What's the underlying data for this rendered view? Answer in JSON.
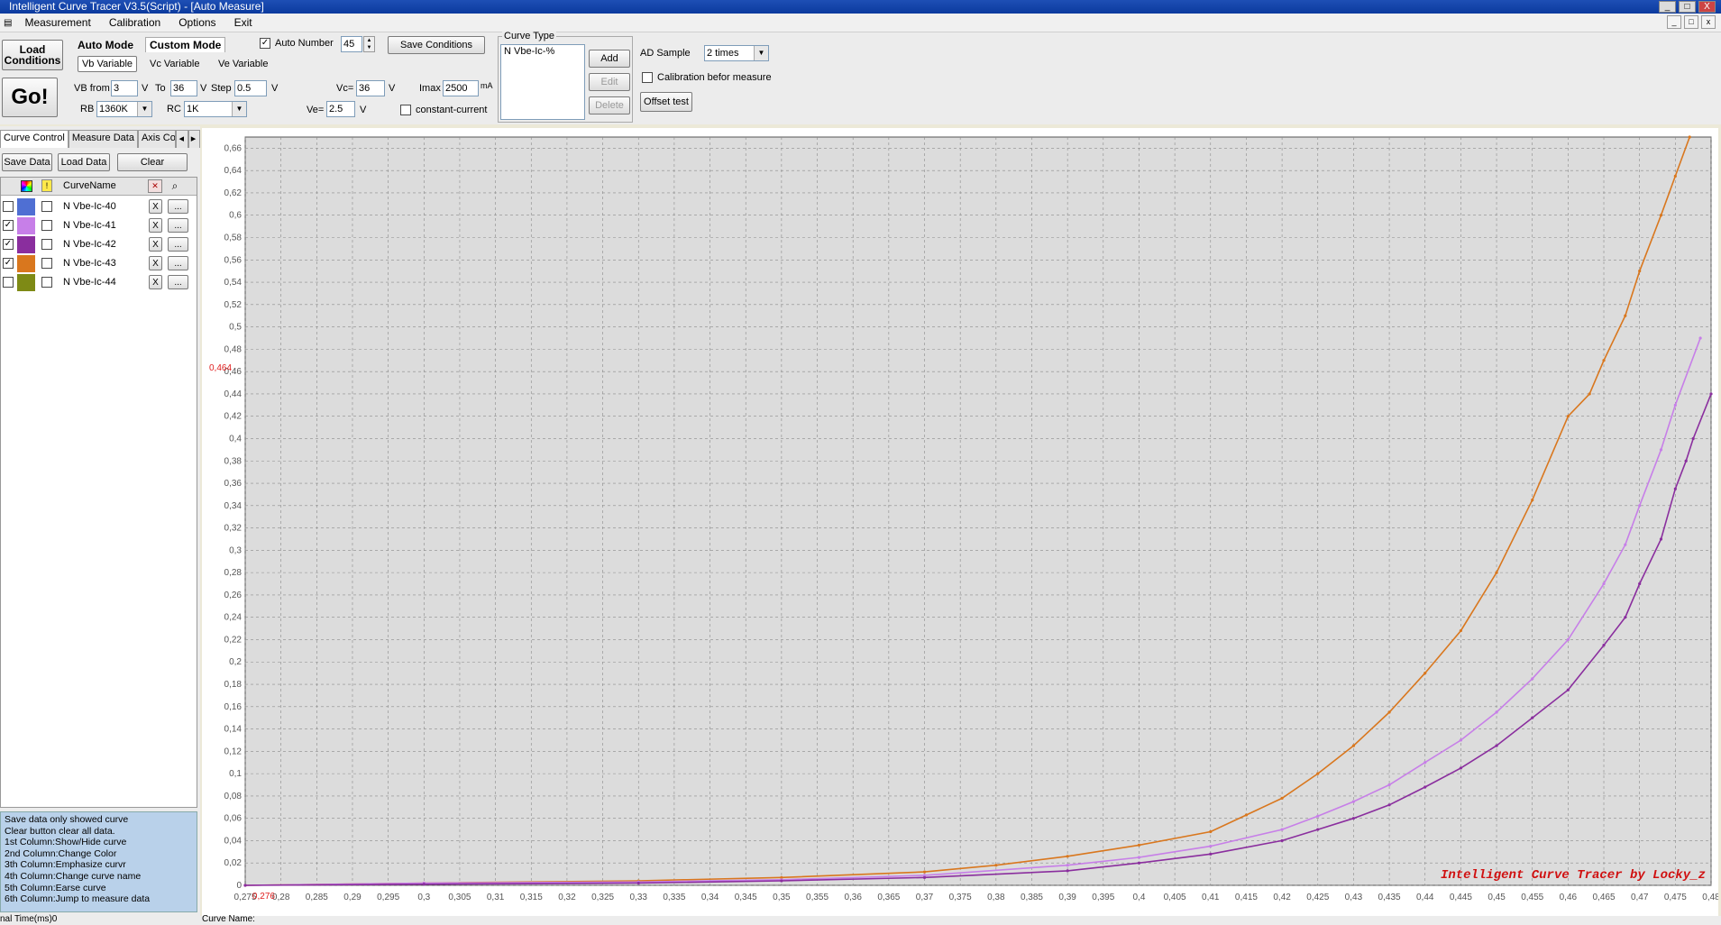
{
  "window": {
    "title": "Intelligent Curve Tracer V3.5(Script) - [Auto Measure]",
    "controls": [
      "_",
      "□",
      "X"
    ],
    "mdi_controls": [
      "_",
      "□",
      "x"
    ]
  },
  "menu": [
    "Measurement",
    "Calibration",
    "Options",
    "Exit"
  ],
  "toolbar": {
    "load_conditions": "Load Conditions",
    "go": "Go!",
    "auto_mode": "Auto Mode",
    "custom_mode": "Custom Mode",
    "vb_variable": "Vb Variable",
    "vc_variable": "Vc Variable",
    "ve_variable": "Ve Variable",
    "auto_number_label": "Auto Number",
    "auto_number_checked": "✓",
    "auto_number_value": "45",
    "save_conditions": "Save Conditions",
    "vb_from_label": "VB from",
    "vb_from": "3",
    "unit_v": "V",
    "to_label": "To",
    "to_value": "36",
    "step_label": "Step",
    "step_value": "0.5",
    "vc_label": "Vc=",
    "vc_value": "36",
    "imax_label": "Imax",
    "imax_value": "2500",
    "imax_unit": "mA",
    "rb_label": "RB",
    "rb_value": "1360K",
    "rc_label": "RC",
    "rc_value": "1K",
    "ve_label": "Ve=",
    "ve_value": "2.5",
    "constant_current": "constant-current",
    "curve_type_title": "Curve Type",
    "curve_type_item": "N Vbe-Ic-%",
    "add": "Add",
    "edit": "Edit",
    "delete": "Delete",
    "ad_sample_label": "AD Sample",
    "ad_sample_value": "2 times",
    "calibration_before": "Calibration befor measure",
    "offset_test": "Offset test"
  },
  "sidebar": {
    "tabs": [
      "Curve Control",
      "Measure Data",
      "Axis Co"
    ],
    "save_data": "Save Data",
    "load_data": "Load Data",
    "clear": "Clear",
    "column_header": "CurveName",
    "curves": [
      {
        "name": "N Vbe-Ic-40",
        "color": "#4f6fd3",
        "shown": "",
        "x": "X",
        "more": "..."
      },
      {
        "name": "N Vbe-Ic-41",
        "color": "#c77fe8",
        "shown": "✓",
        "x": "X",
        "more": "..."
      },
      {
        "name": "N Vbe-Ic-42",
        "color": "#8a2e9e",
        "shown": "✓",
        "x": "X",
        "more": "..."
      },
      {
        "name": "N Vbe-Ic-43",
        "color": "#d9771e",
        "shown": "✓",
        "x": "X",
        "more": "..."
      },
      {
        "name": "N Vbe-Ic-44",
        "color": "#7e8a15",
        "shown": "",
        "x": "X",
        "more": "..."
      }
    ],
    "help_lines": [
      " Save data only showed curve",
      " Clear button clear all data.",
      "1st Column:Show/Hide curve",
      "2nd Column:Change Color",
      "3th Column:Emphasize curvr",
      "4th Column:Change curve name",
      "5th Column:Earse curve",
      "6th Column:Jump to measure data"
    ]
  },
  "status": {
    "left": "nal  Time(ms)0",
    "right": "Curve Name:"
  },
  "chart_data": {
    "type": "line",
    "watermark": "Intelligent Curve Tracer by Locky_z",
    "cursor_y_label": "0,464",
    "cursor_x_label": "0,276",
    "xlim": [
      0.275,
      0.48
    ],
    "ylim": [
      0,
      0.67
    ],
    "x_ticks": [
      "0,275",
      "0,28",
      "0,285",
      "0,29",
      "0,295",
      "0,3",
      "0,305",
      "0,31",
      "0,315",
      "0,32",
      "0,325",
      "0,33",
      "0,335",
      "0,34",
      "0,345",
      "0,35",
      "0,355",
      "0,36",
      "0,365",
      "0,37",
      "0,375",
      "0,38",
      "0,385",
      "0,39",
      "0,395",
      "0,4",
      "0,405",
      "0,41",
      "0,415",
      "0,42",
      "0,425",
      "0,43",
      "0,435",
      "0,44",
      "0,445",
      "0,45",
      "0,455",
      "0,46",
      "0,465",
      "0,47",
      "0,475",
      "0,48"
    ],
    "y_ticks": [
      "0",
      "0,02",
      "0,04",
      "0,06",
      "0,08",
      "0,1",
      "0,12",
      "0,14",
      "0,16",
      "0,18",
      "0,2",
      "0,22",
      "0,24",
      "0,26",
      "0,28",
      "0,3",
      "0,32",
      "0,34",
      "0,36",
      "0,38",
      "0,4",
      "0,42",
      "0,44",
      "0,46",
      "0,48",
      "0,5",
      "0,52",
      "0,54",
      "0,56",
      "0,58",
      "0,6",
      "0,62",
      "0,64",
      "0,66"
    ],
    "grid": true,
    "series": [
      {
        "name": "N Vbe-Ic-43",
        "color": "#d9771e",
        "x": [
          0.275,
          0.3,
          0.33,
          0.35,
          0.37,
          0.38,
          0.39,
          0.4,
          0.41,
          0.415,
          0.42,
          0.425,
          0.43,
          0.435,
          0.44,
          0.445,
          0.45,
          0.455,
          0.46,
          0.463,
          0.465,
          0.468,
          0.47,
          0.473,
          0.475,
          0.477
        ],
        "y": [
          0,
          0.002,
          0.004,
          0.007,
          0.012,
          0.018,
          0.026,
          0.036,
          0.048,
          0.063,
          0.078,
          0.1,
          0.125,
          0.155,
          0.19,
          0.228,
          0.28,
          0.345,
          0.42,
          0.44,
          0.47,
          0.51,
          0.55,
          0.6,
          0.635,
          0.67
        ]
      },
      {
        "name": "N Vbe-Ic-41",
        "color": "#c77fe8",
        "x": [
          0.275,
          0.3,
          0.33,
          0.35,
          0.37,
          0.39,
          0.4,
          0.41,
          0.42,
          0.425,
          0.43,
          0.435,
          0.44,
          0.445,
          0.45,
          0.455,
          0.46,
          0.465,
          0.468,
          0.47,
          0.473,
          0.475,
          0.4785
        ],
        "y": [
          0,
          0.002,
          0.003,
          0.005,
          0.009,
          0.018,
          0.025,
          0.035,
          0.05,
          0.062,
          0.075,
          0.09,
          0.11,
          0.13,
          0.155,
          0.185,
          0.22,
          0.27,
          0.305,
          0.34,
          0.39,
          0.43,
          0.49
        ]
      },
      {
        "name": "N Vbe-Ic-42",
        "color": "#8a2e9e",
        "x": [
          0.275,
          0.3,
          0.33,
          0.35,
          0.37,
          0.39,
          0.4,
          0.41,
          0.42,
          0.425,
          0.43,
          0.435,
          0.44,
          0.445,
          0.45,
          0.455,
          0.46,
          0.465,
          0.468,
          0.47,
          0.473,
          0.475,
          0.4765,
          0.4775,
          0.48
        ],
        "y": [
          0,
          0.001,
          0.002,
          0.004,
          0.007,
          0.013,
          0.02,
          0.028,
          0.04,
          0.05,
          0.06,
          0.072,
          0.088,
          0.105,
          0.125,
          0.15,
          0.175,
          0.215,
          0.24,
          0.27,
          0.31,
          0.355,
          0.38,
          0.4,
          0.44
        ]
      }
    ]
  }
}
